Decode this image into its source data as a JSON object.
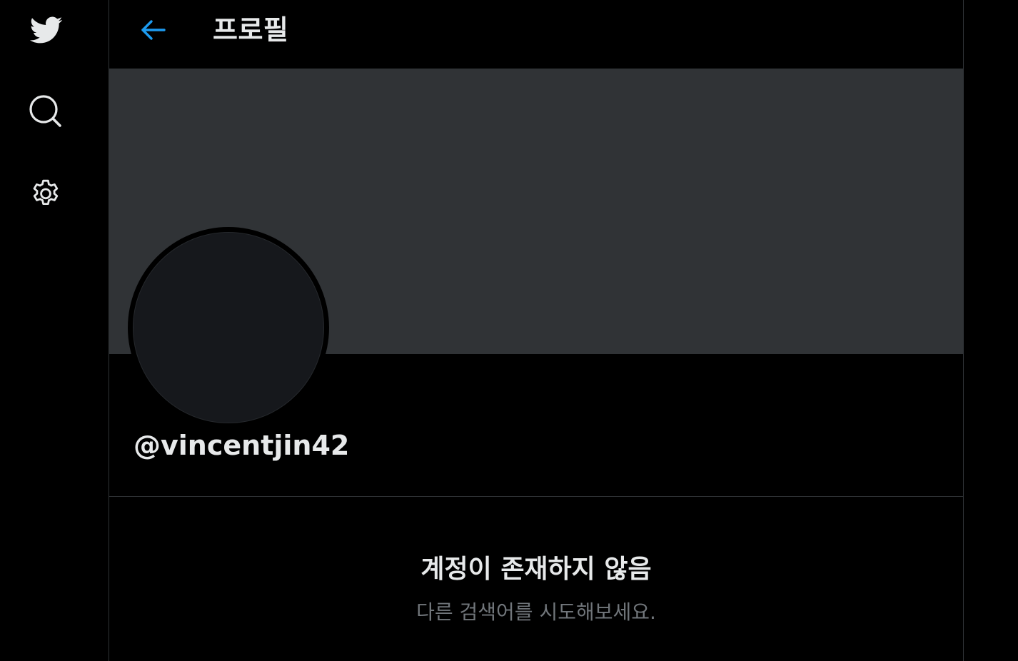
{
  "sidebar": {
    "items": [
      {
        "name": "twitter-logo",
        "icon": "bird-icon"
      },
      {
        "name": "search",
        "icon": "search-icon"
      },
      {
        "name": "settings",
        "icon": "gear-icon"
      }
    ]
  },
  "header": {
    "title": "프로필",
    "back_icon": "arrow-left-icon"
  },
  "profile": {
    "handle": "@vincentjin42"
  },
  "empty_state": {
    "title": "계정이 존재하지 않음",
    "subtitle": "다른 검색어를 시도해보세요."
  },
  "colors": {
    "background": "#000000",
    "accent": "#1d9bf0",
    "banner": "#303336",
    "text_primary": "#e7e9ea",
    "text_secondary": "#71767b",
    "border": "#2f3336"
  }
}
